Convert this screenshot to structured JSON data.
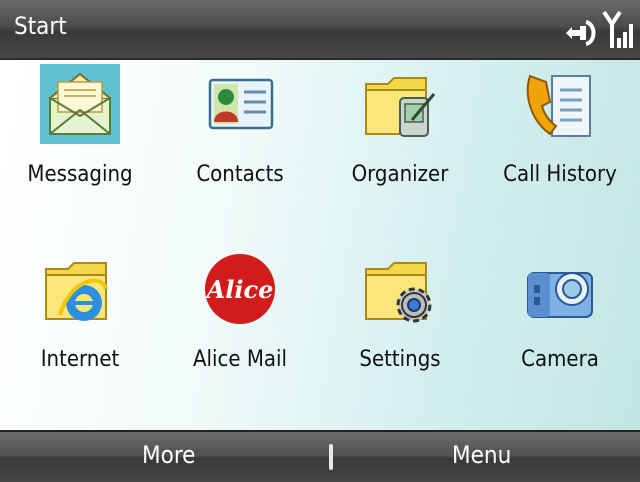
{
  "titlebar": {
    "title": "Start",
    "status_icons": [
      "connection-icon",
      "signal-strength-icon"
    ]
  },
  "tiles": [
    {
      "label": "Messaging",
      "icon": "envelope-icon",
      "selected": true
    },
    {
      "label": "Contacts",
      "icon": "contact-card-icon",
      "selected": false
    },
    {
      "label": "Organizer",
      "icon": "folder-pda-icon",
      "selected": false
    },
    {
      "label": "Call History",
      "icon": "phone-log-icon",
      "selected": false
    },
    {
      "label": "Internet",
      "icon": "folder-ie-icon",
      "selected": false
    },
    {
      "label": "Alice Mail",
      "icon": "alice-logo-icon",
      "selected": false,
      "logo_text": "Alice"
    },
    {
      "label": "Settings",
      "icon": "folder-gear-icon",
      "selected": false
    },
    {
      "label": "Camera",
      "icon": "camera-icon",
      "selected": false
    }
  ],
  "softkeys": {
    "left": "More",
    "right": "Menu"
  }
}
